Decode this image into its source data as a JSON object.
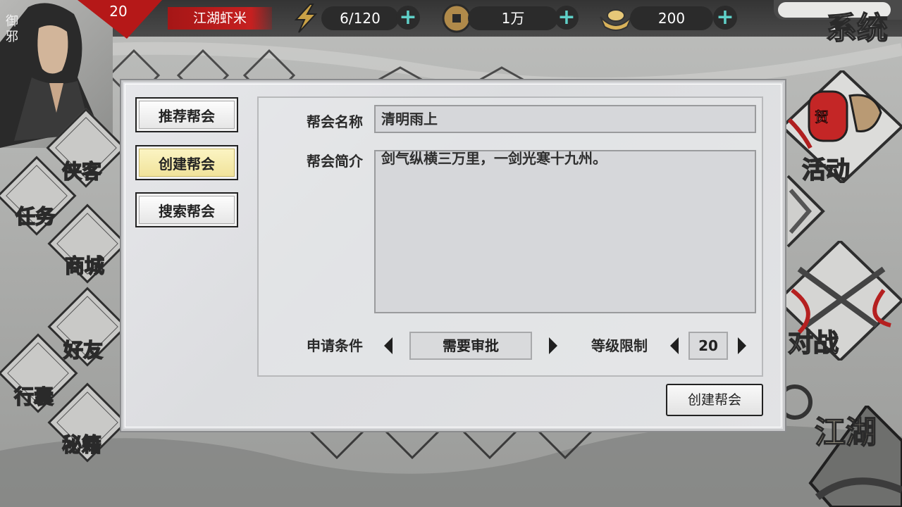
{
  "player": {
    "level": "20",
    "name": "御邪",
    "title": "江湖虾米"
  },
  "resources": {
    "stamina": {
      "icon": "lightning-icon",
      "value": "6/120"
    },
    "coins": {
      "icon": "copper-coin-icon",
      "value": "1万"
    },
    "ingots": {
      "icon": "gold-ingot-icon",
      "value": "200"
    }
  },
  "right_menu": {
    "system": "系统",
    "activity": "活动",
    "activity_lantern": "贺",
    "battle": "对战",
    "jianghu": "江湖"
  },
  "left_menu": {
    "xiake": "侠客",
    "task": "任务",
    "shop": "商城",
    "friends": "好友",
    "bag": "行囊",
    "manual": "秘籍"
  },
  "modal": {
    "tabs": [
      {
        "label": "推荐帮会",
        "active": false
      },
      {
        "label": "创建帮会",
        "active": true
      },
      {
        "label": "搜索帮会",
        "active": false
      }
    ],
    "form": {
      "name_label": "帮会名称",
      "name_value": "清明雨上",
      "desc_label": "帮会简介",
      "desc_value": "剑气纵横三万里，一剑光寒十九州。",
      "apply_label": "申请条件",
      "apply_value": "需要审批",
      "level_label": "等级限制",
      "level_value": "20"
    },
    "submit_label": "创建帮会"
  },
  "colors": {
    "accent": "#f1e39b",
    "title_badge": "#c62020",
    "plus": "#5fd0c8"
  }
}
